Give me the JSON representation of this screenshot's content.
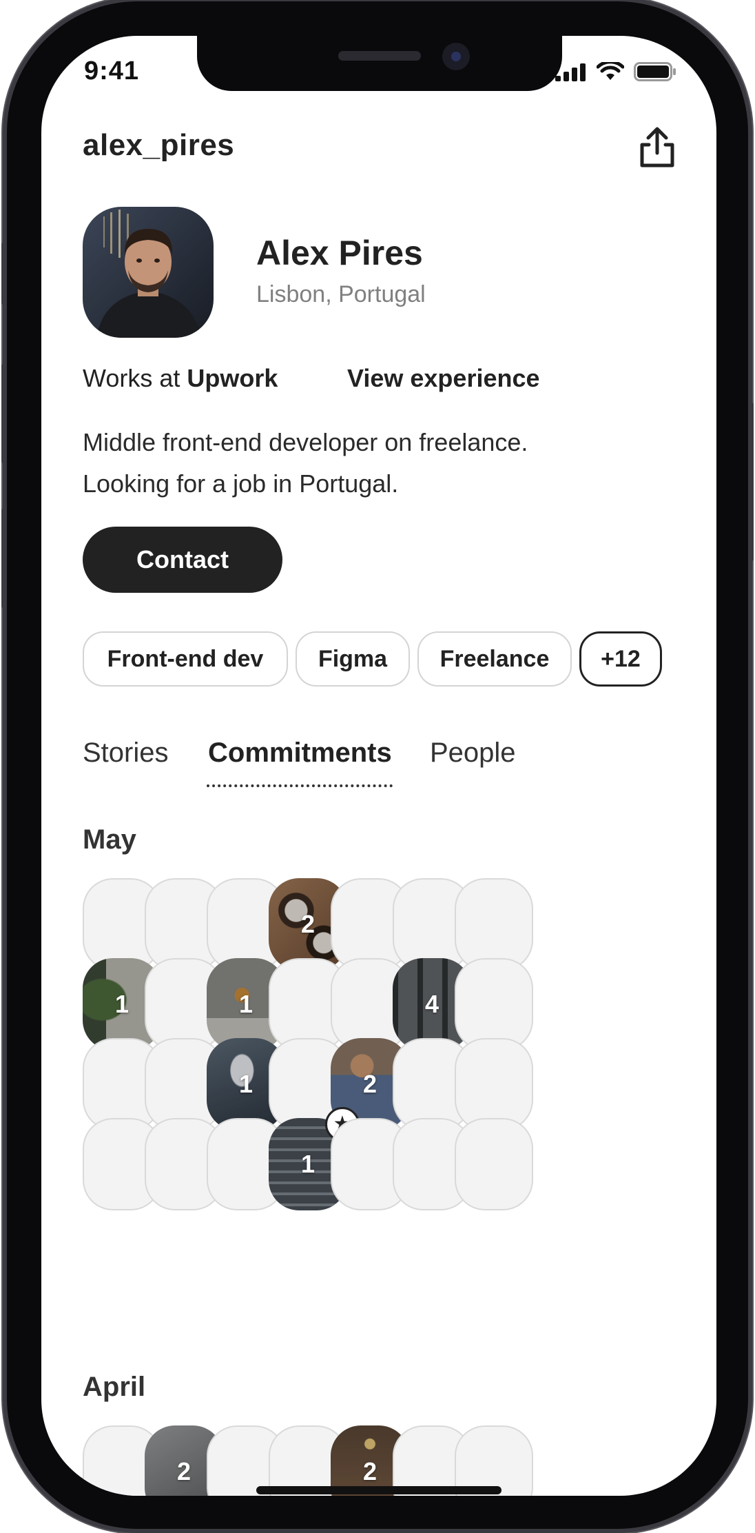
{
  "status_bar": {
    "time": "9:41"
  },
  "header": {
    "username": "alex_pires"
  },
  "profile": {
    "name": "Alex Pires",
    "location": "Lisbon, Portugal",
    "works_at_prefix": "Works at",
    "company": "Upwork",
    "view_experience": "View experience",
    "bio_line1": "Middle front-end developer on freelance.",
    "bio_line2": "Looking for a job in Portugal.",
    "contact_label": "Contact"
  },
  "tags": [
    "Front-end dev",
    "Figma",
    "Freelance",
    "+12"
  ],
  "tabs": [
    {
      "label": "Stories",
      "active": false
    },
    {
      "label": "Commitments",
      "active": true
    },
    {
      "label": "People",
      "active": false
    }
  ],
  "months": [
    {
      "name": "May",
      "photo_days": [
        {
          "week": 1,
          "day": 4,
          "count": "2",
          "theme": "coffee"
        },
        {
          "week": 2,
          "day": 1,
          "count": "1",
          "theme": "plant"
        },
        {
          "week": 2,
          "day": 3,
          "count": "1",
          "theme": "office"
        },
        {
          "week": 2,
          "day": 6,
          "count": "4",
          "theme": "glass"
        },
        {
          "week": 3,
          "day": 3,
          "count": "1",
          "theme": "reading"
        },
        {
          "week": 3,
          "day": 5,
          "count": "2",
          "theme": "meeting"
        },
        {
          "week": 4,
          "day": 4,
          "count": "1",
          "theme": "building",
          "starred": true
        }
      ]
    },
    {
      "name": "April",
      "photo_days": [
        {
          "week": 1,
          "day": 2,
          "count": "2",
          "theme": "grey"
        },
        {
          "week": 1,
          "day": 5,
          "count": "2",
          "theme": "warm"
        }
      ]
    }
  ],
  "colors": {
    "primary_dark": "#222222",
    "empty_cell_fill": "#f3f3f3",
    "empty_cell_border": "#d9d9d9",
    "secondary_text": "#808080"
  }
}
